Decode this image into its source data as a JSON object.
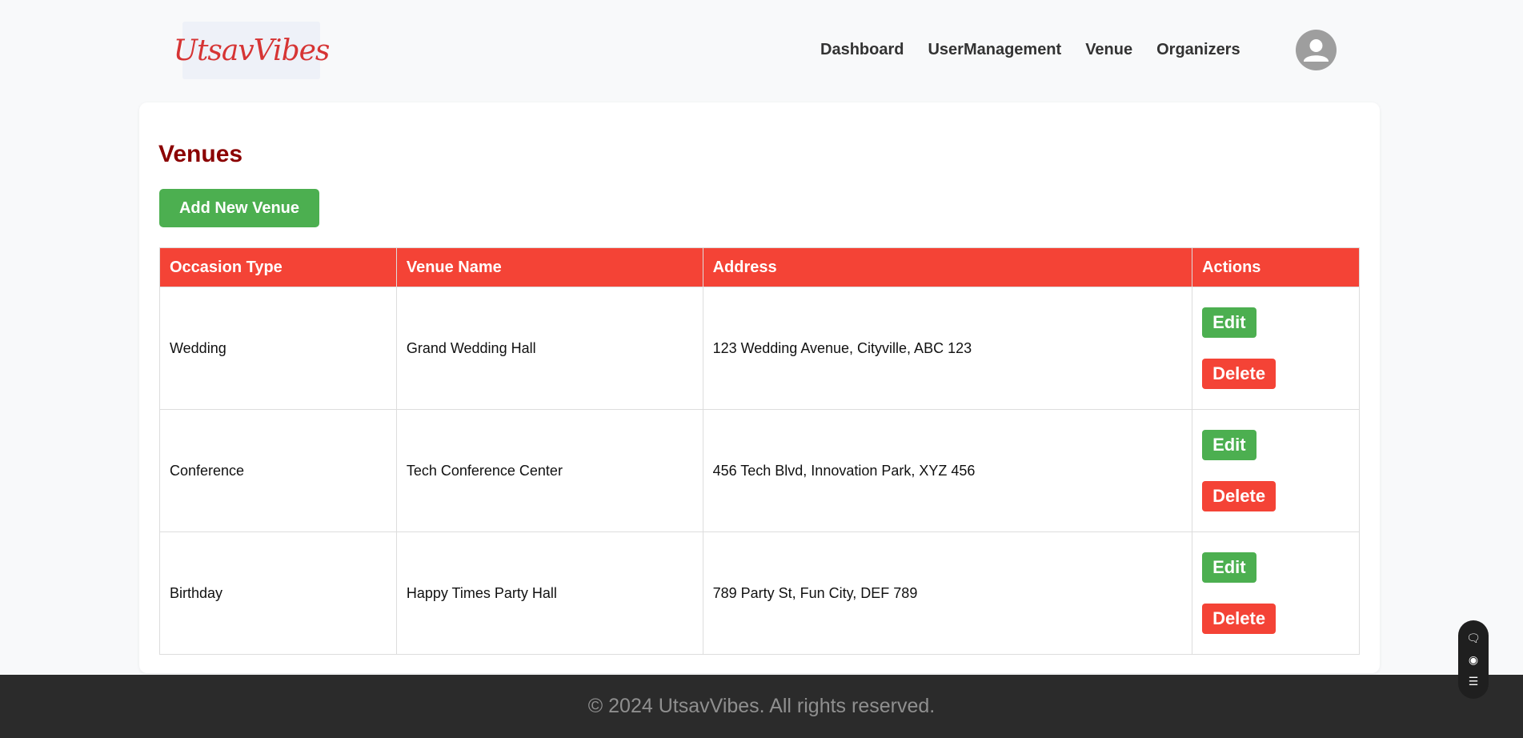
{
  "brand": {
    "logo_text": "UtsavVibes"
  },
  "nav": {
    "items": [
      "Dashboard",
      "UserManagement",
      "Venue",
      "Organizers"
    ]
  },
  "page": {
    "title": "Venues",
    "add_button": "Add New Venue"
  },
  "table": {
    "headers": [
      "Occasion Type",
      "Venue Name",
      "Address",
      "Actions"
    ],
    "rows": [
      {
        "occasion": "Wedding",
        "venue": "Grand Wedding Hall",
        "address": "123 Wedding Avenue, Cityville, ABC 123"
      },
      {
        "occasion": "Conference",
        "venue": "Tech Conference Center",
        "address": "456 Tech Blvd, Innovation Park, XYZ 456"
      },
      {
        "occasion": "Birthday",
        "venue": "Happy Times Party Hall",
        "address": "789 Party St, Fun City, DEF 789"
      }
    ],
    "edit_label": "Edit",
    "delete_label": "Delete"
  },
  "footer": {
    "text": "© 2024 UtsavVibes. All rights reserved."
  },
  "widget": {
    "icons": [
      "chat-icon",
      "eye-icon",
      "list-icon"
    ]
  },
  "colors": {
    "header_red": "#f44336",
    "title_red": "#8b0000",
    "green": "#4caf50",
    "footer_bg": "#2b2b2b"
  }
}
